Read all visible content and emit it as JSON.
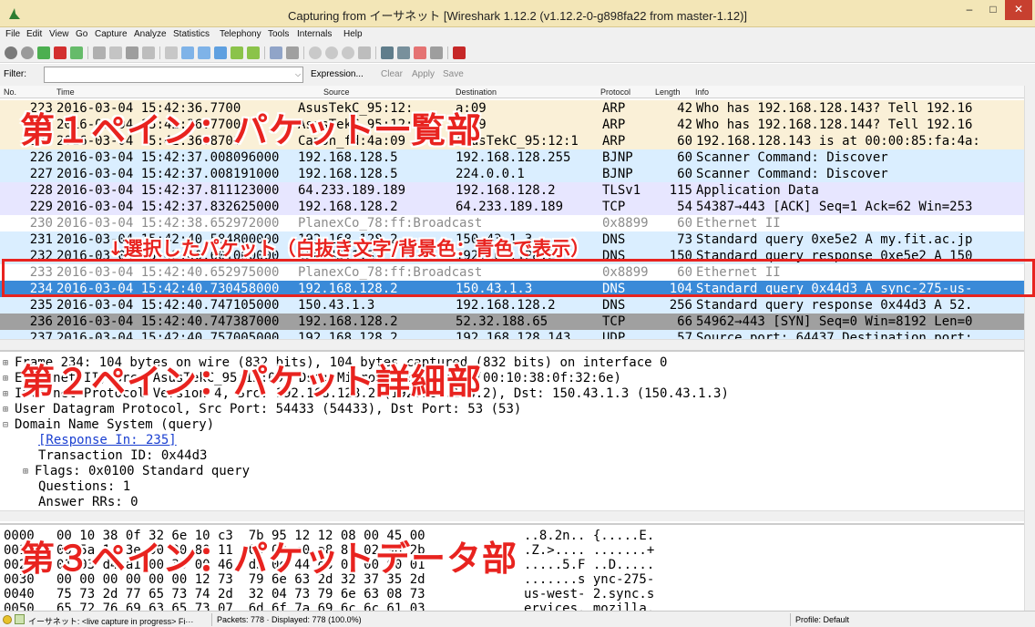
{
  "window": {
    "title": "Capturing from イーサネット   [Wireshark 1.12.2  (v1.12.2-0-g898fa22 from master-1.12)]",
    "minimize": "–",
    "maximize": "□",
    "close": "✕"
  },
  "menu": [
    "File",
    "Edit",
    "View",
    "Go",
    "Capture",
    "Analyze",
    "Statistics",
    "Telephony",
    "Tools",
    "Internals",
    "Help"
  ],
  "filter": {
    "label": "Filter:",
    "value": "",
    "dropdown": "⌵",
    "expression": "Expression...",
    "clear": "Clear",
    "apply": "Apply",
    "save": "Save"
  },
  "columns": {
    "no": "No.",
    "time": "Time",
    "source": "Source",
    "destination": "Destination",
    "protocol": "Protocol",
    "length": "Length",
    "info": "Info"
  },
  "packets": [
    {
      "no": "223",
      "time": "2016-03-04 15:42:36.7700",
      "src": "AsusTekC_95:12:",
      "dst": "a:09",
      "proto": "ARP",
      "len": "42",
      "info": "Who has 192.168.128.143?  Tell 192.16",
      "bg": "#faf0d7"
    },
    {
      "no": "224",
      "time": "2016-03-04 15:42:36.7700",
      "src": "AsusTekC_95:12:",
      "dst": "a:09",
      "proto": "ARP",
      "len": "42",
      "info": "Who has 192.168.128.144?  Tell 192.16",
      "bg": "#faf0d7"
    },
    {
      "no": "225",
      "time": "2016-03-04 15:42:36.8700",
      "src": "Canon_fd:4a:09",
      "dst": "AsusTekC_95:12:1",
      "proto": "ARP",
      "len": "60",
      "info": "192.168.128.143 is at 00:00:85:fa:4a:",
      "bg": "#faf0d7"
    },
    {
      "no": "226",
      "time": "2016-03-04 15:42:37.008096000",
      "src": "192.168.128.5",
      "dst": "192.168.128.255",
      "proto": "BJNP",
      "len": "60",
      "info": "Scanner Command: Discover",
      "bg": "#daeeff"
    },
    {
      "no": "227",
      "time": "2016-03-04 15:42:37.008191000",
      "src": "192.168.128.5",
      "dst": "224.0.0.1",
      "proto": "BJNP",
      "len": "60",
      "info": "Scanner Command: Discover",
      "bg": "#daeeff"
    },
    {
      "no": "228",
      "time": "2016-03-04 15:42:37.811123000",
      "src": "64.233.189.189",
      "dst": "192.168.128.2",
      "proto": "TLSv1",
      "len": "115",
      "info": "Application Data",
      "bg": "#e7e6ff"
    },
    {
      "no": "229",
      "time": "2016-03-04 15:42:37.832625000",
      "src": "192.168.128.2",
      "dst": "64.233.189.189",
      "proto": "TCP",
      "len": "54",
      "info": "54387→443 [ACK] Seq=1 Ack=62 Win=253",
      "bg": "#e7e6ff"
    },
    {
      "no": "230",
      "time": "2016-03-04 15:42:38.652972000",
      "src": "PlanexCo_78:ff:Broadcast",
      "dst": "",
      "proto": "0x8899",
      "len": "60",
      "info": "Ethernet II",
      "bg": "#ffffff",
      "fg": "#8c8c8c"
    },
    {
      "no": "231",
      "time": "2016-03-04 15:42:40.584800000",
      "src": "192.168.128.2",
      "dst": "150.43.1.3",
      "proto": "DNS",
      "len": "73",
      "info": "Standard query 0xe5e2  A my.fit.ac.jp",
      "bg": "#daeeff"
    },
    {
      "no": "232",
      "time": "2016-03-04 15:42:40.601000000",
      "src": "150.43.1.3",
      "dst": "192.168.128.2",
      "proto": "DNS",
      "len": "150",
      "info": "Standard query response 0xe5e2  A 150",
      "bg": "#daeeff"
    },
    {
      "no": "233",
      "time": "2016-03-04 15:42:40.652975000",
      "src": "PlanexCo_78:ff:Broadcast",
      "dst": "",
      "proto": "0x8899",
      "len": "60",
      "info": "Ethernet II",
      "bg": "#ffffff",
      "fg": "#8c8c8c"
    },
    {
      "no": "234",
      "time": "2016-03-04 15:42:40.730458000",
      "src": "192.168.128.2",
      "dst": "150.43.1.3",
      "proto": "DNS",
      "len": "104",
      "info": "Standard query 0x44d3  A sync-275-us-",
      "bg": "#3a8ad8",
      "fg": "#ffffff"
    },
    {
      "no": "235",
      "time": "2016-03-04 15:42:40.747105000",
      "src": "150.43.1.3",
      "dst": "192.168.128.2",
      "proto": "DNS",
      "len": "256",
      "info": "Standard query response 0x44d3  A 52.",
      "bg": "#daeeff"
    },
    {
      "no": "236",
      "time": "2016-03-04 15:42:40.747387000",
      "src": "192.168.128.2",
      "dst": "52.32.188.65",
      "proto": "TCP",
      "len": "66",
      "info": "54962→443 [SYN] Seq=0 Win=8192 Len=0",
      "bg": "#a0a0a0"
    },
    {
      "no": "237",
      "time": "2016-03-04 15:42:40.757005000",
      "src": "192.168.128.2",
      "dst": "192.168.128.143",
      "proto": "UDP",
      "len": "57",
      "info": "Source port: 64437  Destination port:",
      "bg": "#daeeff"
    }
  ],
  "details": [
    {
      "exp": "⊞",
      "text": "Frame 234: 104 bytes on wire (832 bits), 104 bytes captured (832 bits) on interface 0",
      "indent": 0
    },
    {
      "exp": "⊞",
      "text": "Ethernet II, Src: AsusTekC_95:12:09, Dst: MicroRes_0f:32:6e (00:10:38:0f:32:6e)",
      "indent": 0
    },
    {
      "exp": "⊞",
      "text": "Internet Protocol Version 4, Src: 192.168.128.2 (192.168.128.2), Dst: 150.43.1.3 (150.43.1.3)",
      "indent": 0
    },
    {
      "exp": "⊞",
      "text": "User Datagram Protocol, Src Port: 54433 (54433), Dst Port: 53 (53)",
      "indent": 0
    },
    {
      "exp": "⊟",
      "text": "Domain Name System (query)",
      "indent": 0
    },
    {
      "exp": "",
      "text": "[Response In: 235]",
      "indent": 1,
      "link": true
    },
    {
      "exp": "",
      "text": "Transaction ID: 0x44d3",
      "indent": 1
    },
    {
      "exp": "⊞",
      "text": "Flags: 0x0100 Standard query",
      "indent": 1
    },
    {
      "exp": "",
      "text": "Questions: 1",
      "indent": 1
    },
    {
      "exp": "",
      "text": "Answer RRs: 0",
      "indent": 1
    }
  ],
  "bytes": [
    {
      "off": "0000",
      "hex": "00 10 38 0f 32 6e 10 c3  7b 95 12 12 08 00 45 00",
      "ascii": "..8.2n.. {.....E."
    },
    {
      "off": "0010",
      "hex": "00 5a 1a 3e 00 00 80 11  00 00 c0 a8 80 02 96 2b",
      "ascii": ".Z.>.... .......+"
    },
    {
      "off": "0020",
      "hex": "01 03 d4 a1 00 35 00 46  d3 0d 44 d3 01 00 00 01",
      "ascii": ".....5.F ..D....."
    },
    {
      "off": "0030",
      "hex": "00 00 00 00 00 00 12 73  79 6e 63 2d 32 37 35 2d",
      "ascii": ".......s ync-275-"
    },
    {
      "off": "0040",
      "hex": "75 73 2d 77 65 73 74 2d  32 04 73 79 6e 63 08 73",
      "ascii": "us-west- 2.sync.s"
    },
    {
      "off": "0050",
      "hex": "65 72 76 69 63 65 73 07  6d 6f 7a 69 6c 6c 61 03",
      "ascii": "ervices. mozilla."
    }
  ],
  "status": {
    "capture": "イーサネット: <live capture in progress> Fi···",
    "packets": "Packets: 778 · Displayed: 778 (100.0%)",
    "profile": "Profile: Default"
  },
  "annotations": {
    "pane1": "第１ペイン：パケット一覧部",
    "pane2": "第２ペイン：パケット詳細部",
    "pane3": "第３ペイン：パケットデータ部",
    "selected": "↓選択したパケット（白抜き文字/背景色：青色で表示）"
  }
}
